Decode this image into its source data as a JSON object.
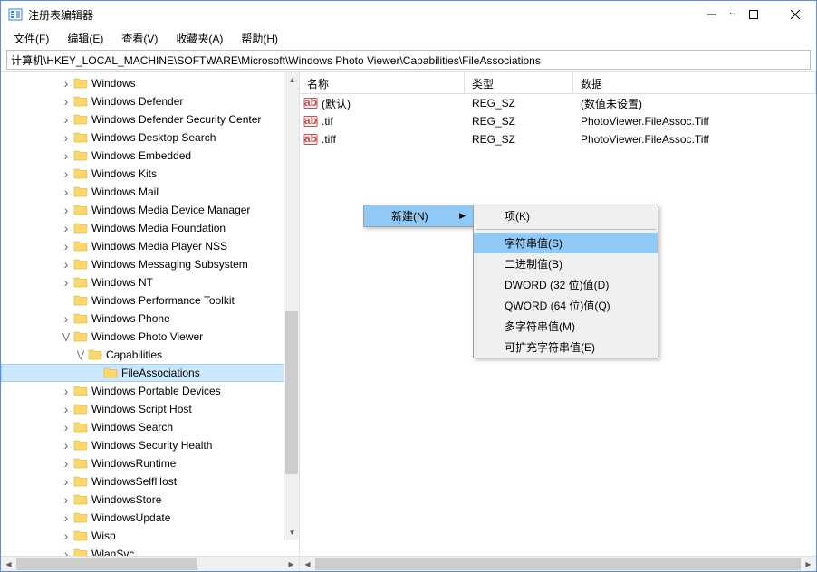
{
  "window": {
    "title": "注册表编辑器"
  },
  "menubar": [
    "文件(F)",
    "编辑(E)",
    "查看(V)",
    "收藏夹(A)",
    "帮助(H)"
  ],
  "address": "计算机\\HKEY_LOCAL_MACHINE\\SOFTWARE\\Microsoft\\Windows Photo Viewer\\Capabilities\\FileAssociations",
  "tree": [
    {
      "label": "Windows",
      "depth": 4,
      "exp": ">"
    },
    {
      "label": "Windows Defender",
      "depth": 4,
      "exp": ">"
    },
    {
      "label": "Windows Defender Security Center",
      "depth": 4,
      "exp": ">"
    },
    {
      "label": "Windows Desktop Search",
      "depth": 4,
      "exp": ">"
    },
    {
      "label": "Windows Embedded",
      "depth": 4,
      "exp": ">"
    },
    {
      "label": "Windows Kits",
      "depth": 4,
      "exp": ">"
    },
    {
      "label": "Windows Mail",
      "depth": 4,
      "exp": ">"
    },
    {
      "label": "Windows Media Device Manager",
      "depth": 4,
      "exp": ">"
    },
    {
      "label": "Windows Media Foundation",
      "depth": 4,
      "exp": ">"
    },
    {
      "label": "Windows Media Player NSS",
      "depth": 4,
      "exp": ">"
    },
    {
      "label": "Windows Messaging Subsystem",
      "depth": 4,
      "exp": ">"
    },
    {
      "label": "Windows NT",
      "depth": 4,
      "exp": ">"
    },
    {
      "label": "Windows Performance Toolkit",
      "depth": 4,
      "exp": ""
    },
    {
      "label": "Windows Phone",
      "depth": 4,
      "exp": ">"
    },
    {
      "label": "Windows Photo Viewer",
      "depth": 4,
      "exp": "v"
    },
    {
      "label": "Capabilities",
      "depth": 5,
      "exp": "v"
    },
    {
      "label": "FileAssociations",
      "depth": 6,
      "exp": "",
      "selected": true
    },
    {
      "label": "Windows Portable Devices",
      "depth": 4,
      "exp": ">"
    },
    {
      "label": "Windows Script Host",
      "depth": 4,
      "exp": ">"
    },
    {
      "label": "Windows Search",
      "depth": 4,
      "exp": ">"
    },
    {
      "label": "Windows Security Health",
      "depth": 4,
      "exp": ">"
    },
    {
      "label": "WindowsRuntime",
      "depth": 4,
      "exp": ">"
    },
    {
      "label": "WindowsSelfHost",
      "depth": 4,
      "exp": ">"
    },
    {
      "label": "WindowsStore",
      "depth": 4,
      "exp": ">"
    },
    {
      "label": "WindowsUpdate",
      "depth": 4,
      "exp": ">"
    },
    {
      "label": "Wisp",
      "depth": 4,
      "exp": ">"
    },
    {
      "label": "WlanSvc",
      "depth": 4,
      "exp": ">"
    }
  ],
  "columns": {
    "name": "名称",
    "type": "类型",
    "data": "数据"
  },
  "values": [
    {
      "name": "(默认)",
      "type": "REG_SZ",
      "data_": "(数值未设置)"
    },
    {
      "name": ".tif",
      "type": "REG_SZ",
      "data_": "PhotoViewer.FileAssoc.Tiff"
    },
    {
      "name": ".tiff",
      "type": "REG_SZ",
      "data_": "PhotoViewer.FileAssoc.Tiff"
    }
  ],
  "context1": {
    "new": "新建(N)"
  },
  "context2": [
    {
      "label": "项(K)",
      "sep_after": true
    },
    {
      "label": "字符串值(S)",
      "hl": true
    },
    {
      "label": "二进制值(B)"
    },
    {
      "label": "DWORD (32 位)值(D)"
    },
    {
      "label": "QWORD (64 位)值(Q)"
    },
    {
      "label": "多字符串值(M)"
    },
    {
      "label": "可扩充字符串值(E)"
    }
  ]
}
